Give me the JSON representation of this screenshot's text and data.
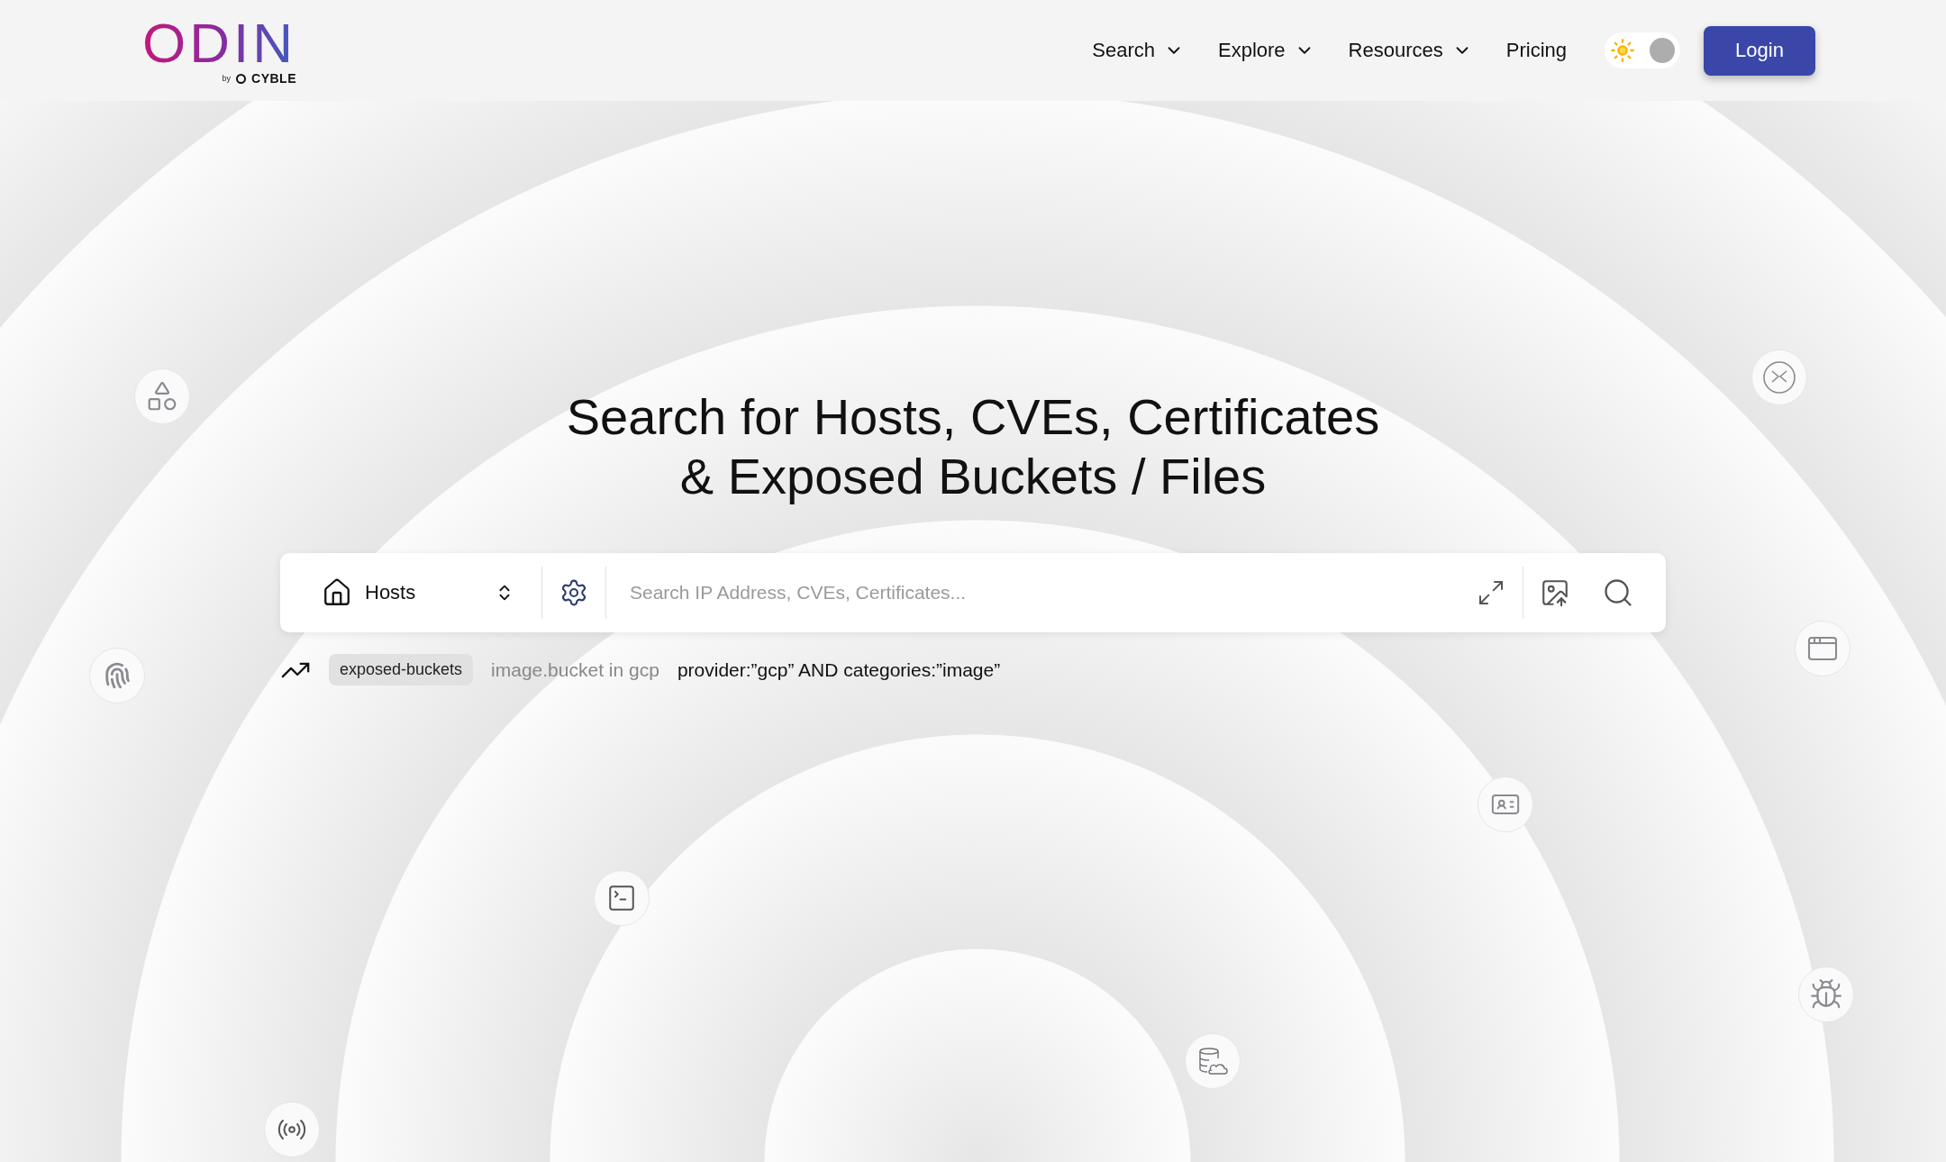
{
  "header": {
    "logo": {
      "wordmark": "ODIN",
      "by": "by",
      "brand": "CYBLE"
    },
    "nav": [
      {
        "label": "Search",
        "dropdown": true
      },
      {
        "label": "Explore",
        "dropdown": true
      },
      {
        "label": "Resources",
        "dropdown": true
      },
      {
        "label": "Pricing",
        "dropdown": false
      }
    ],
    "theme_toggle": {
      "dark": false
    },
    "login": "Login"
  },
  "hero": {
    "title_lines": [
      "Search for Hosts, CVEs, Certificates",
      "& Exposed Buckets / Files"
    ]
  },
  "search": {
    "scope": "Hosts",
    "placeholder": "Search IP Address, CVEs, Certificates..."
  },
  "trending": {
    "tag": "exposed-buckets",
    "label": "image.bucket in gcp",
    "query": "provider:”gcp” AND categories:”image”"
  }
}
